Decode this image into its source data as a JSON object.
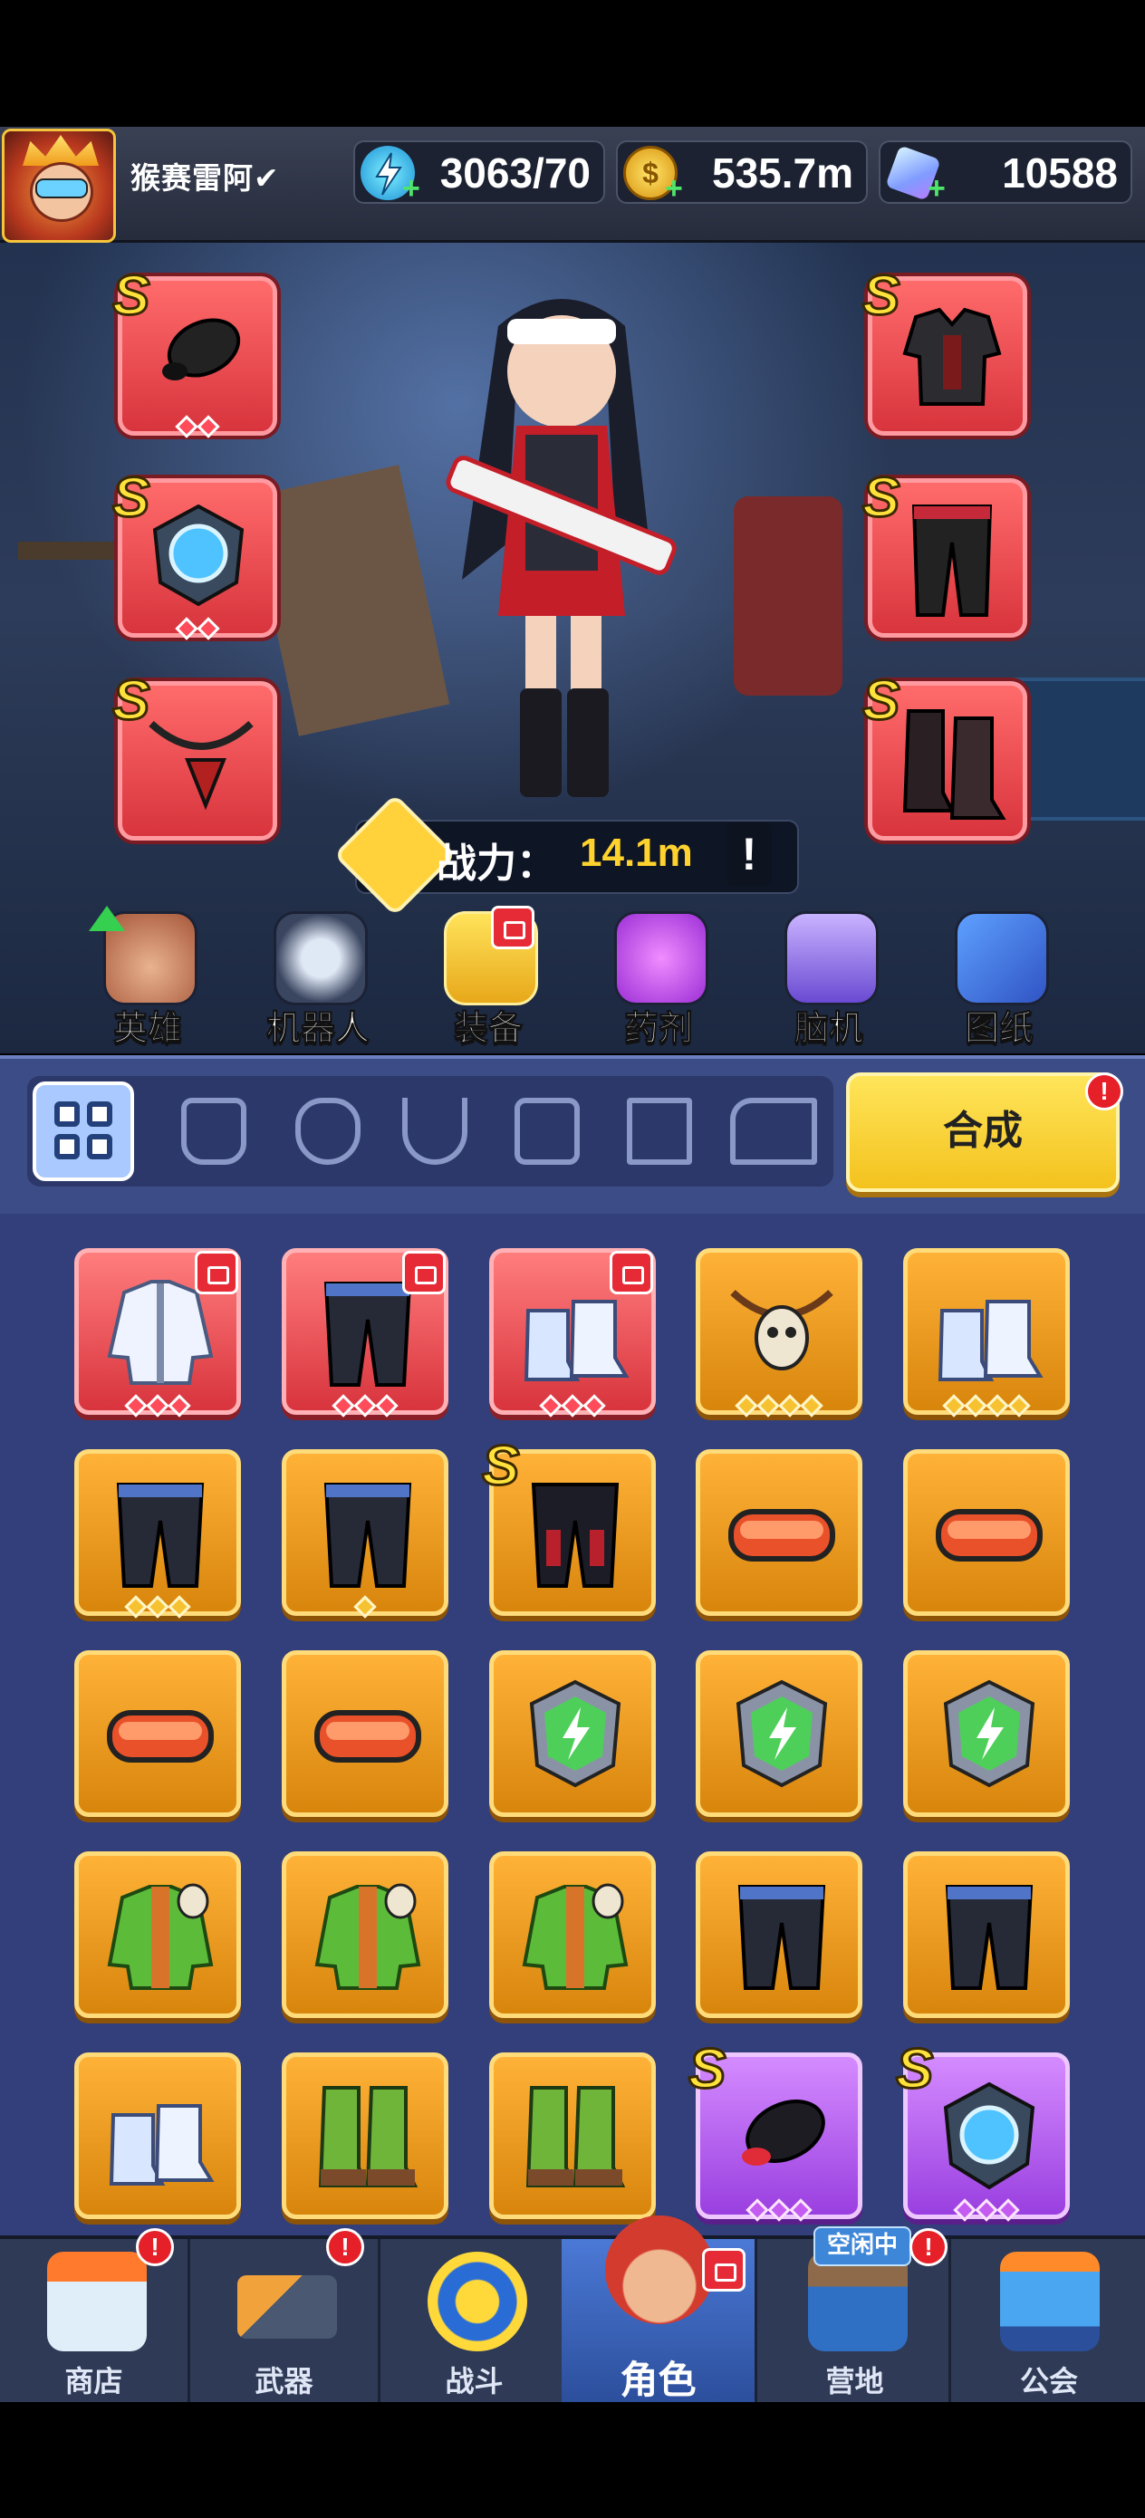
{
  "header": {
    "player_name": "猴赛雷阿✔",
    "energy": "3063/70",
    "coins": "535.7m",
    "gems": "10588"
  },
  "hero": {
    "power_label": "战力：",
    "power_value": "14.1m",
    "power_info": "!",
    "equipped_slots": [
      {
        "slot": "weapon-part",
        "grade": "S"
      },
      {
        "slot": "armor",
        "grade": "S"
      },
      {
        "slot": "shield-core",
        "grade": "S"
      },
      {
        "slot": "pants",
        "grade": "S"
      },
      {
        "slot": "necklace",
        "grade": "S"
      },
      {
        "slot": "boots",
        "grade": "S"
      }
    ]
  },
  "categories": [
    {
      "label": "英雄"
    },
    {
      "label": "机器人"
    },
    {
      "label": "装备"
    },
    {
      "label": "药剂"
    },
    {
      "label": "脑机"
    },
    {
      "label": "图纸"
    }
  ],
  "filters": [
    "all",
    "gloves",
    "armor",
    "necklace",
    "vest",
    "pants",
    "boots"
  ],
  "merge_button": "合成",
  "alert_mark": "!",
  "idle_tag": "空闲中",
  "nav": [
    {
      "label": "商店"
    },
    {
      "label": "武器"
    },
    {
      "label": "战斗"
    },
    {
      "label": "角色"
    },
    {
      "label": "营地"
    },
    {
      "label": "公会"
    }
  ],
  "inventory": [
    {
      "item": "white-fur-jacket",
      "rarity": "red",
      "stars": 3,
      "locked": true
    },
    {
      "item": "black-pants",
      "rarity": "red",
      "stars": 3,
      "locked": true
    },
    {
      "item": "fur-boots",
      "rarity": "red",
      "stars": 3,
      "locked": true
    },
    {
      "item": "skull-necklace",
      "rarity": "gold",
      "stars": 4
    },
    {
      "item": "fur-boots",
      "rarity": "gold",
      "stars": 4
    },
    {
      "item": "black-pants",
      "rarity": "gold",
      "stars": 3
    },
    {
      "item": "black-pants",
      "rarity": "gold",
      "stars": 1
    },
    {
      "item": "armored-pants",
      "rarity": "gold",
      "stars": 0,
      "grade": "S"
    },
    {
      "item": "goggles",
      "rarity": "gold",
      "stars": 0
    },
    {
      "item": "goggles",
      "rarity": "gold",
      "stars": 0
    },
    {
      "item": "goggles",
      "rarity": "gold",
      "stars": 0
    },
    {
      "item": "goggles",
      "rarity": "gold",
      "stars": 0
    },
    {
      "item": "energy-badge",
      "rarity": "gold",
      "stars": 0
    },
    {
      "item": "energy-badge",
      "rarity": "gold",
      "stars": 0
    },
    {
      "item": "energy-badge",
      "rarity": "gold",
      "stars": 0
    },
    {
      "item": "green-skull-jacket",
      "rarity": "gold",
      "stars": 0
    },
    {
      "item": "green-skull-jacket",
      "rarity": "gold",
      "stars": 0
    },
    {
      "item": "green-skull-jacket",
      "rarity": "gold",
      "stars": 0
    },
    {
      "item": "black-pants",
      "rarity": "gold",
      "stars": 0
    },
    {
      "item": "black-pants",
      "rarity": "gold",
      "stars": 0
    },
    {
      "item": "fur-boots",
      "rarity": "gold",
      "stars": 0
    },
    {
      "item": "green-boots",
      "rarity": "gold",
      "stars": 0
    },
    {
      "item": "green-boots",
      "rarity": "gold",
      "stars": 0
    },
    {
      "item": "black-capsule",
      "rarity": "purple",
      "stars": 3,
      "grade": "S"
    },
    {
      "item": "shield-core",
      "rarity": "purple",
      "stars": 3,
      "grade": "S"
    }
  ],
  "colors": {
    "red_rarity": "#d8343d",
    "gold_rarity": "#e8950f",
    "purple_rarity": "#a94ce8",
    "accent_yellow": "#ffd22e",
    "panel_blue": "#333f7a"
  }
}
